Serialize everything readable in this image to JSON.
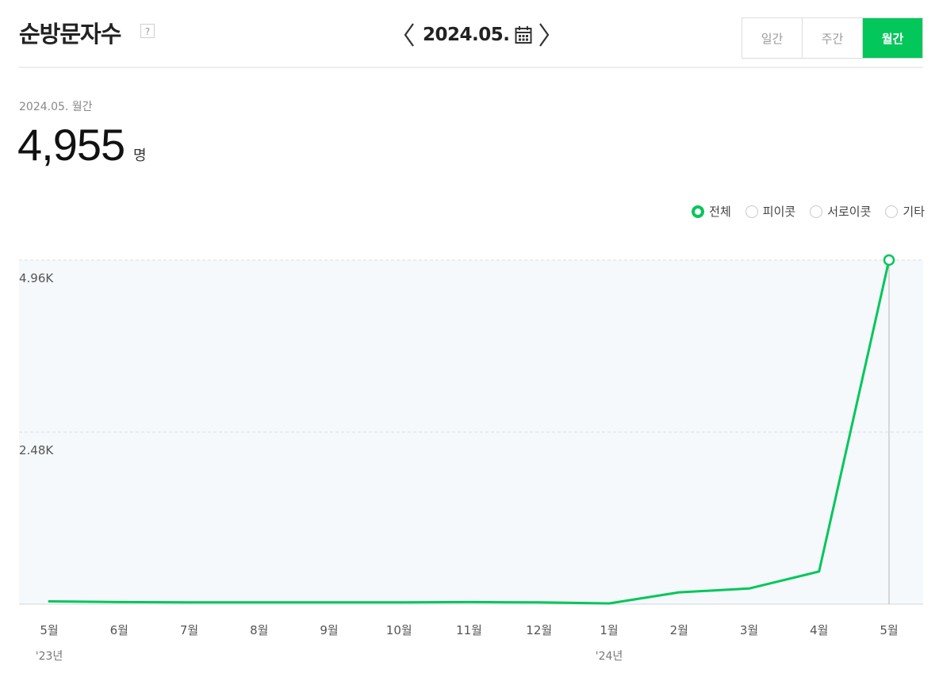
{
  "header": {
    "title": "순방문자수",
    "help_icon": "?",
    "date_label": "2024.05."
  },
  "period_toggle": [
    {
      "label": "일간",
      "active": false
    },
    {
      "label": "주간",
      "active": false
    },
    {
      "label": "월간",
      "active": true
    }
  ],
  "summary": {
    "label": "2024.05. 월간",
    "value": "4,955",
    "unit": "명"
  },
  "legend": [
    {
      "label": "전체",
      "selected": true
    },
    {
      "label": "피이콧",
      "selected": false
    },
    {
      "label": "서로이콧",
      "selected": false
    },
    {
      "label": "기타",
      "selected": false
    }
  ],
  "colors": {
    "accent": "#03c75a",
    "plot_bg": "#f5f9fc",
    "grid": "#d8e0e6"
  },
  "chart_data": {
    "type": "line",
    "categories": [
      "5월",
      "6월",
      "7월",
      "8월",
      "9월",
      "10월",
      "11월",
      "12월",
      "1월",
      "2월",
      "3월",
      "4월",
      "5월"
    ],
    "year_labels": [
      {
        "index": 0,
        "label": "'23년"
      },
      {
        "index": 8,
        "label": "'24년"
      }
    ],
    "series": [
      {
        "values": [
          40,
          30,
          25,
          25,
          25,
          25,
          30,
          25,
          10,
          170,
          225,
          470,
          4955
        ]
      }
    ],
    "y_ticks": [
      {
        "value": 2478,
        "label": "2.48K"
      },
      {
        "value": 4955,
        "label": "4.96K"
      }
    ],
    "ylim": [
      0,
      4955
    ],
    "highlight_index": 12,
    "grid": true
  }
}
